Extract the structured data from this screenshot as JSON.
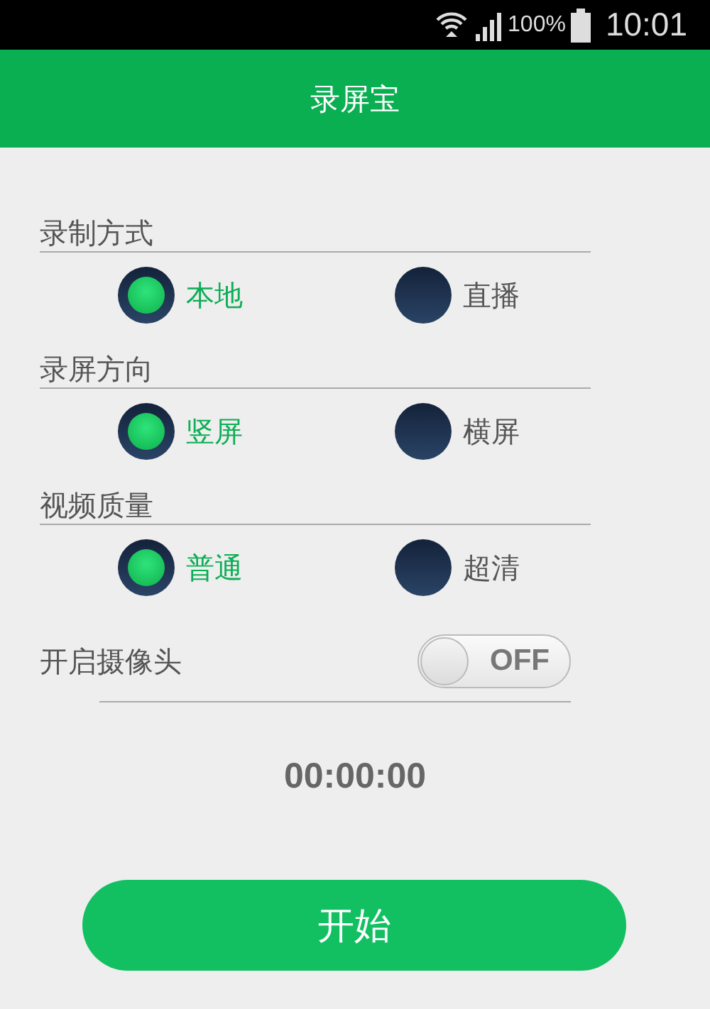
{
  "status_bar": {
    "battery": "100%",
    "time": "10:01"
  },
  "app_bar": {
    "title": "录屏宝"
  },
  "option_groups": [
    {
      "label": "录制方式",
      "options": [
        {
          "label": "本地",
          "selected": true
        },
        {
          "label": "直播",
          "selected": false
        }
      ]
    },
    {
      "label": "录屏方向",
      "options": [
        {
          "label": "竖屏",
          "selected": true
        },
        {
          "label": "横屏",
          "selected": false
        }
      ]
    },
    {
      "label": "视频质量",
      "options": [
        {
          "label": "普通",
          "selected": true
        },
        {
          "label": "超清",
          "selected": false
        }
      ]
    }
  ],
  "camera": {
    "label": "开启摄像头",
    "on": false,
    "state_text": "OFF"
  },
  "timer": "00:00:00",
  "start_button": "开始"
}
